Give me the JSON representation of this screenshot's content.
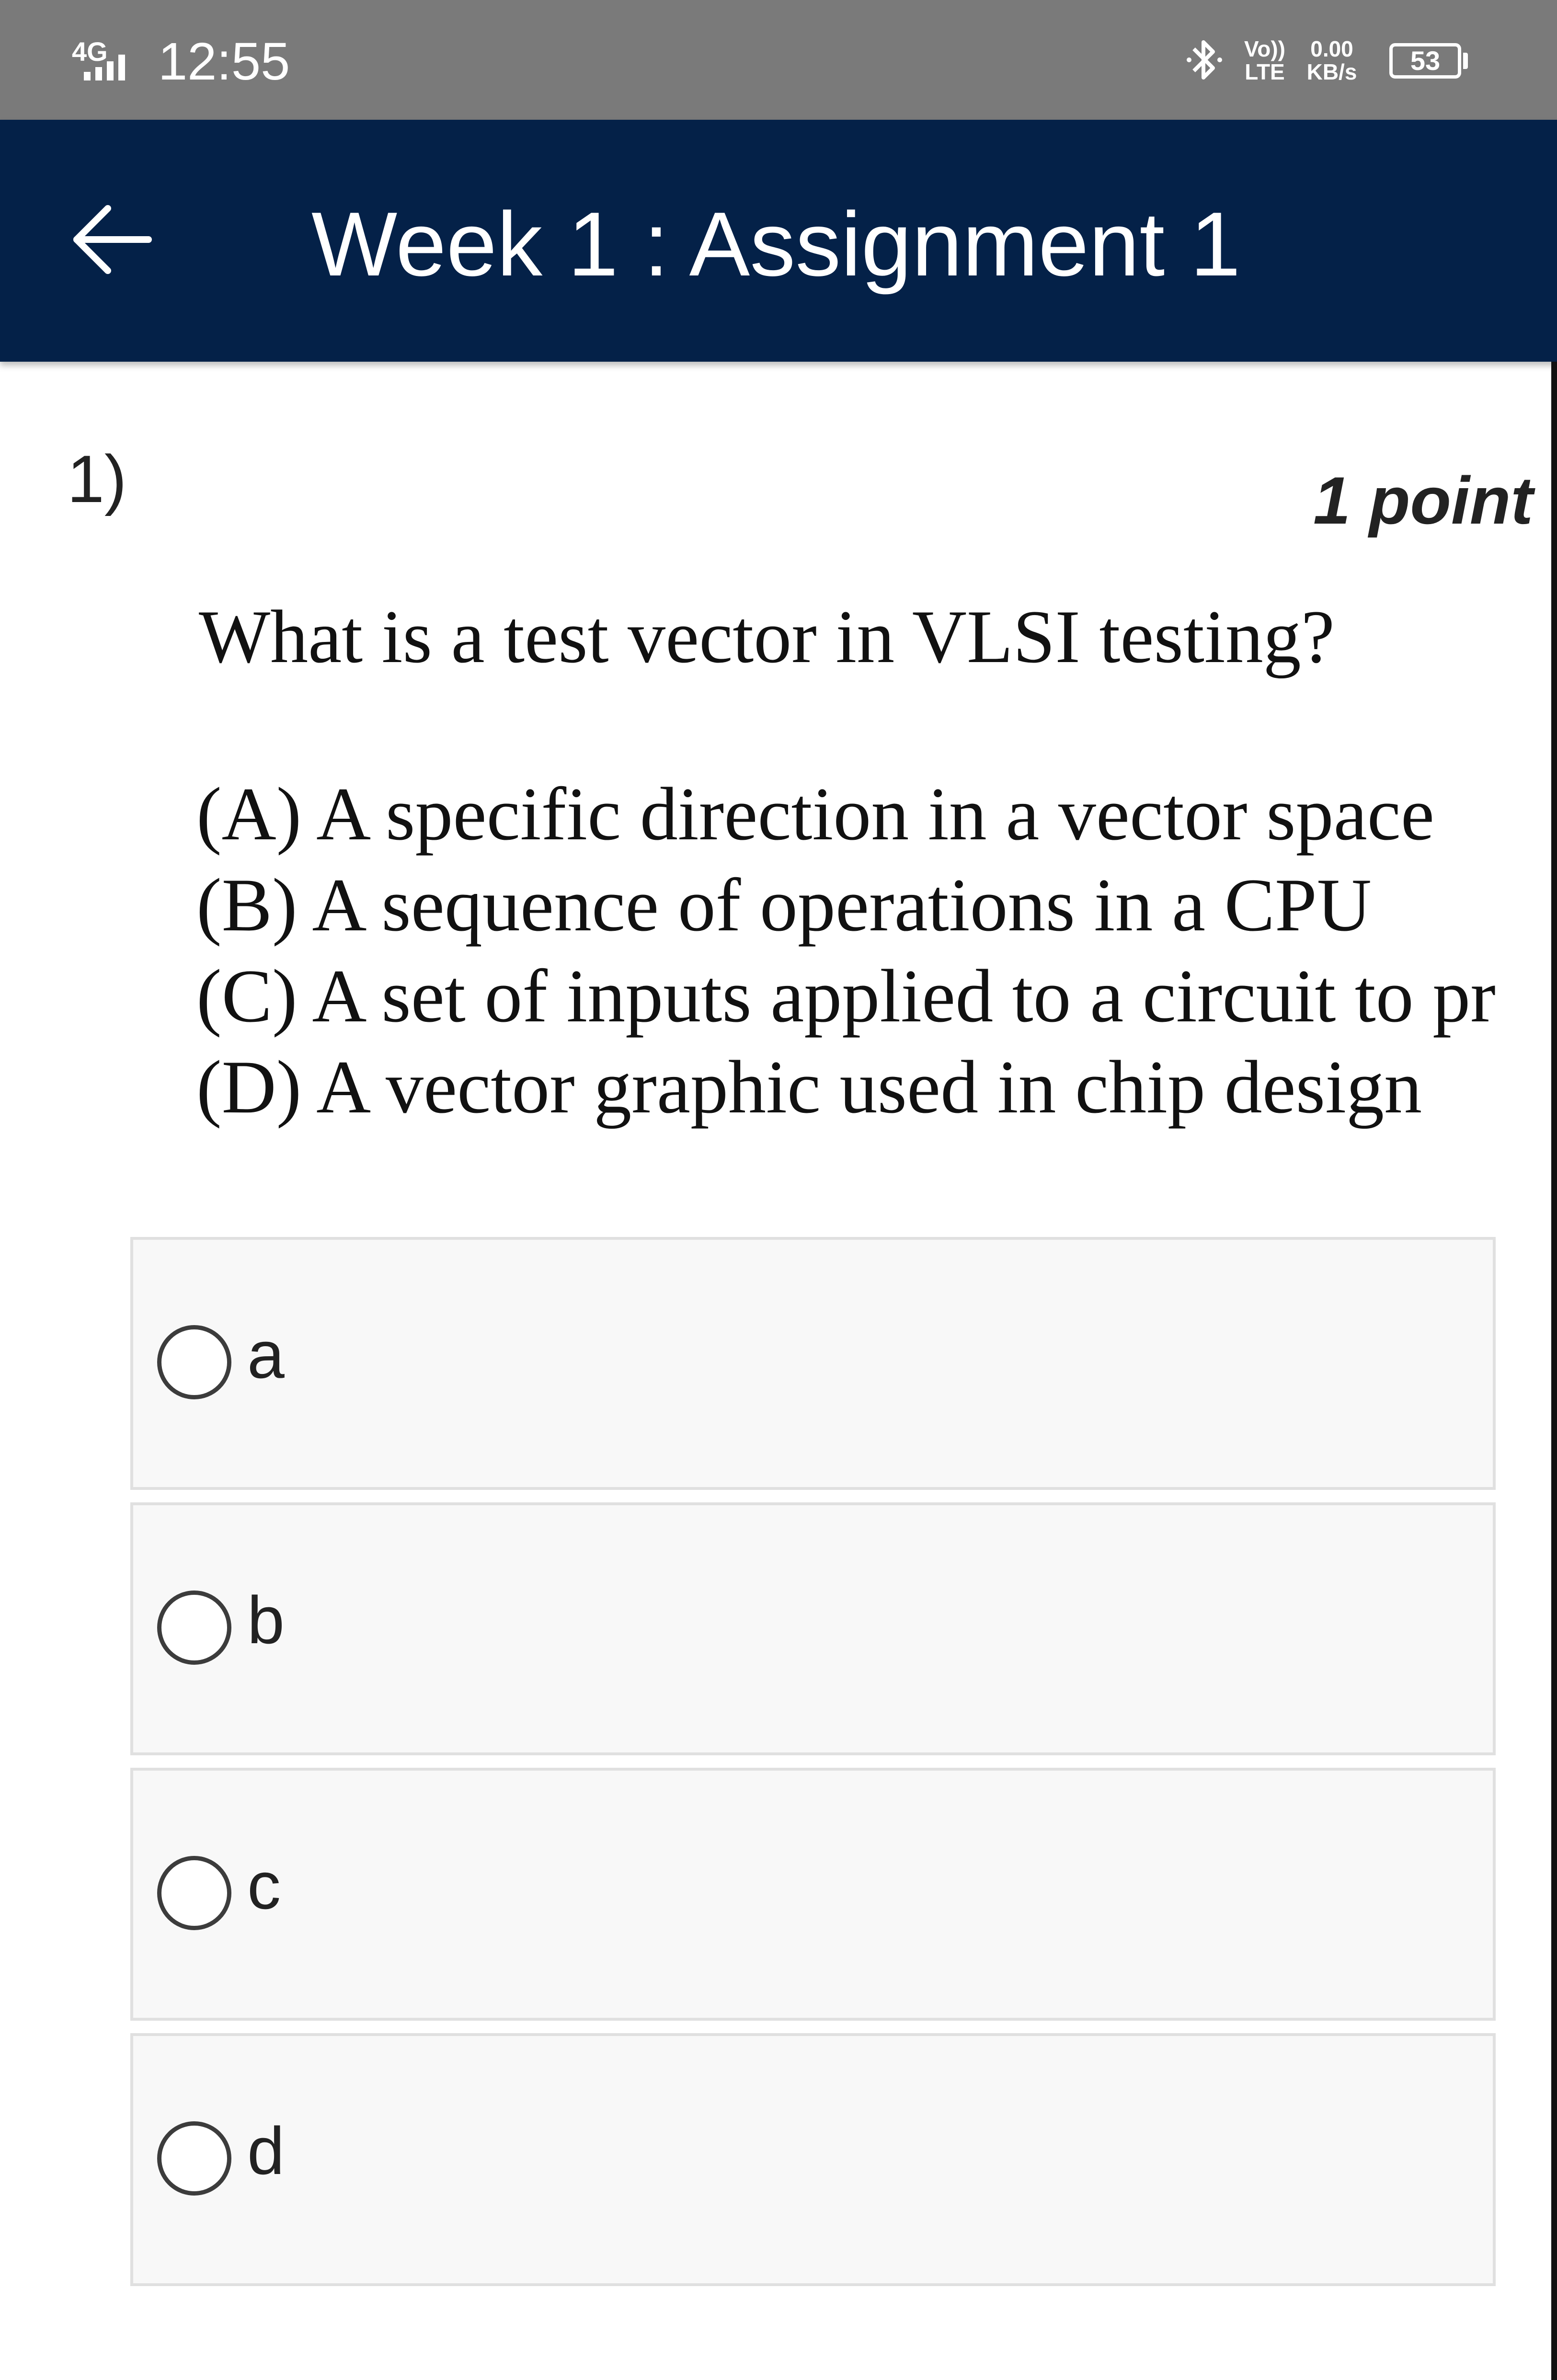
{
  "status_bar": {
    "network": "4G",
    "time": "12:55",
    "volte_top": "Vo))",
    "volte_bottom": "LTE",
    "speed_value": "0.00",
    "speed_unit": "KB/s",
    "battery": "53",
    "icons": [
      "signal-icon",
      "bluetooth-icon",
      "battery-icon"
    ]
  },
  "app_bar": {
    "title": "Week 1 : Assignment 1",
    "back_icon": "arrow-left-icon",
    "background": "#042148"
  },
  "question": {
    "number": "1)",
    "points": "1 point",
    "text": "What is a test vector in VLSI testing?",
    "options": [
      "(A) A specific direction in a vector space",
      "(B) A sequence of operations in a CPU",
      "(C) A set of inputs applied to a circuit to pr",
      "(D) A vector graphic used in chip design"
    ]
  },
  "choices": [
    {
      "label": "a",
      "selected": false
    },
    {
      "label": "b",
      "selected": false
    },
    {
      "label": "c",
      "selected": false
    },
    {
      "label": "d",
      "selected": false
    }
  ]
}
